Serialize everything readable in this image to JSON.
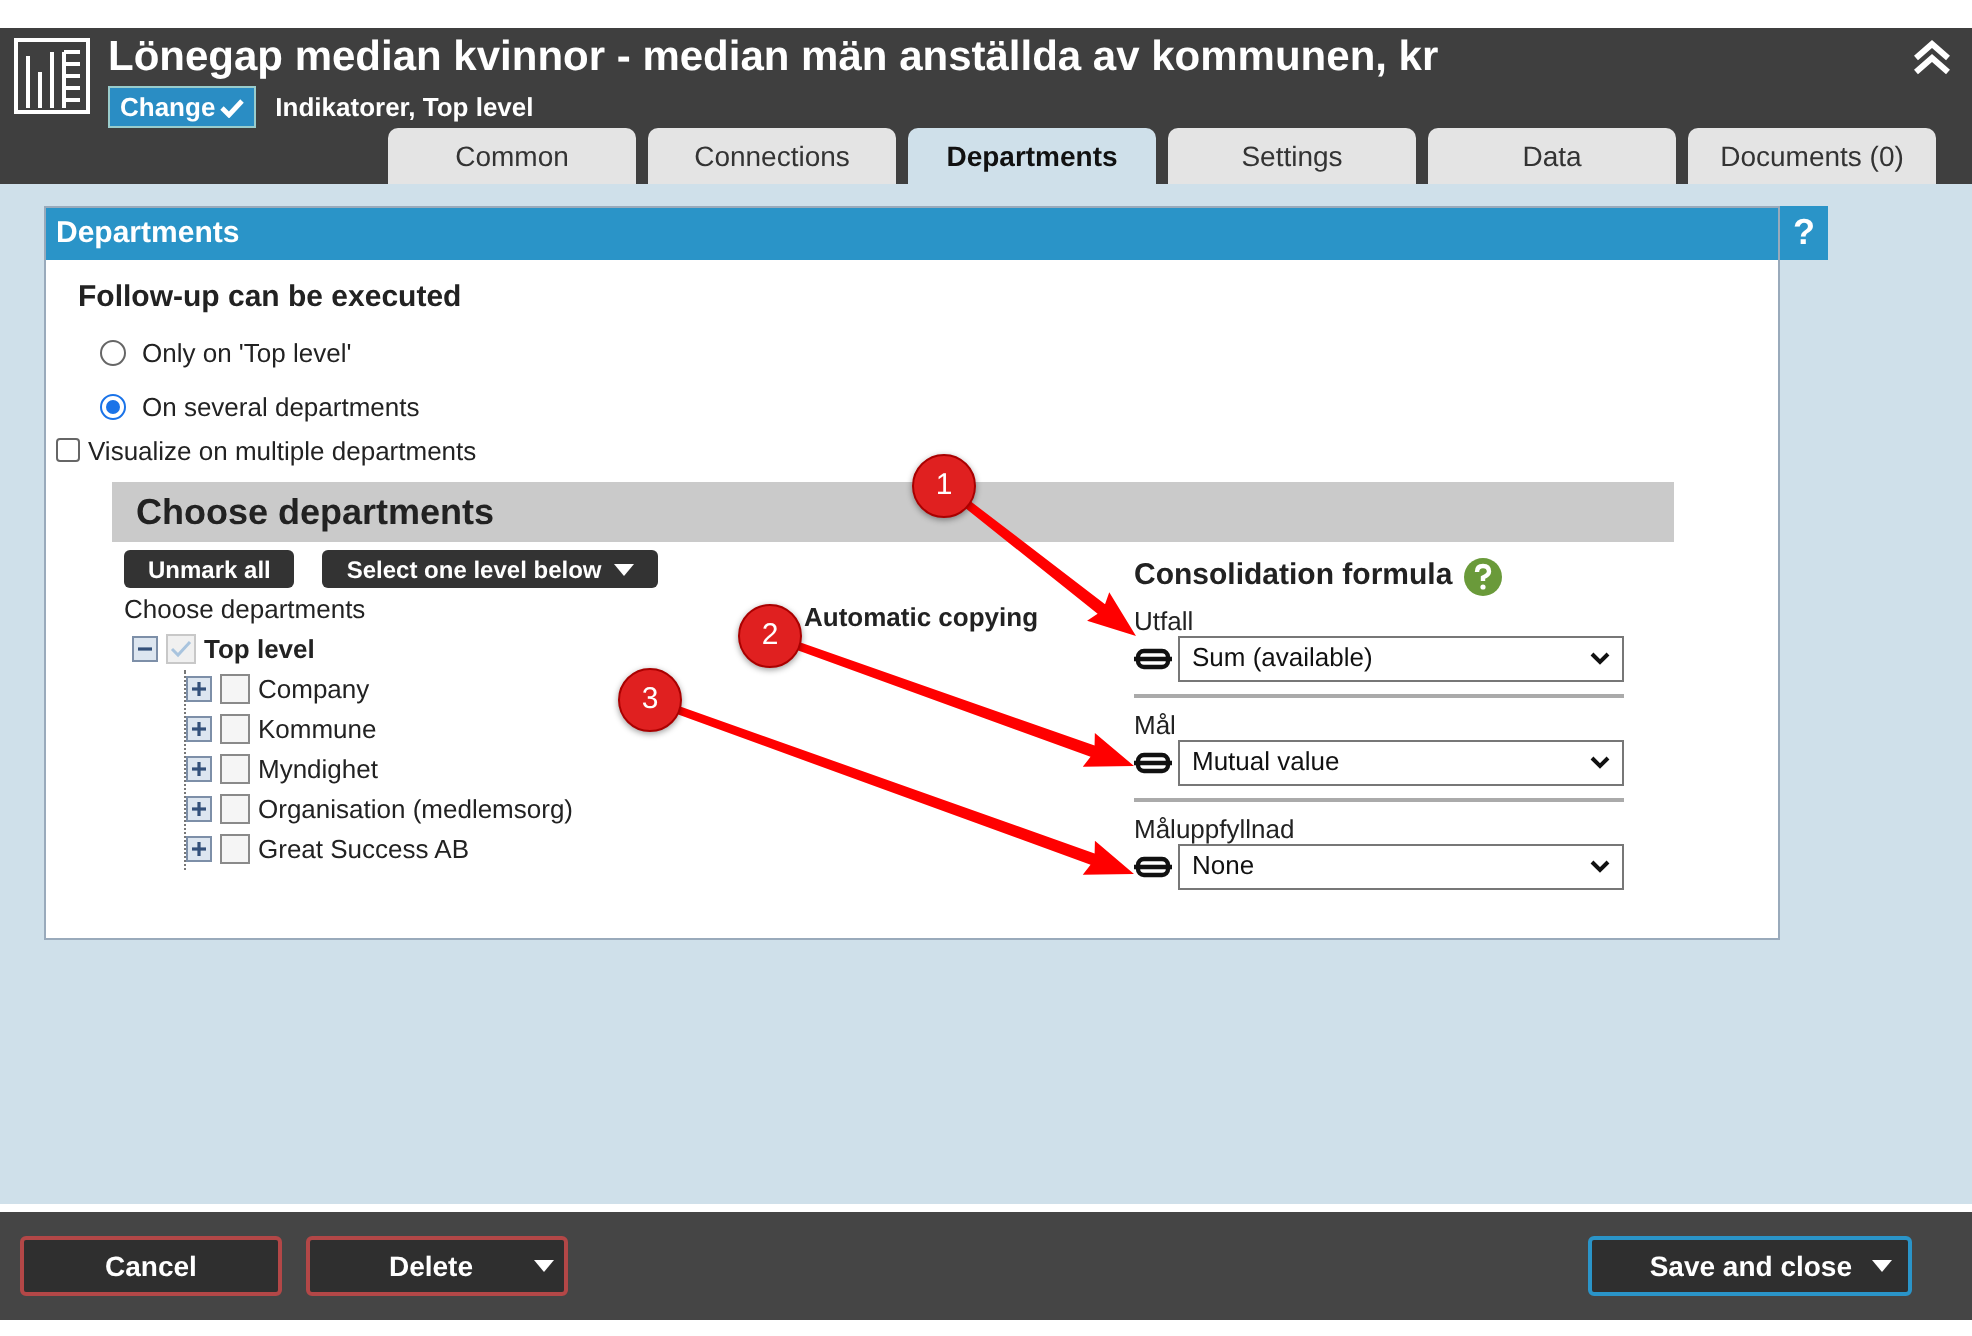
{
  "header": {
    "title": "Lönegap median kvinnor - median män anställda av kommunen, kr",
    "change_button": "Change",
    "subtitle": "Indikatorer, Top level"
  },
  "tabs": [
    {
      "label": "Common",
      "selected": false
    },
    {
      "label": "Connections",
      "selected": false
    },
    {
      "label": "Departments",
      "selected": true
    },
    {
      "label": "Settings",
      "selected": false
    },
    {
      "label": "Data",
      "selected": false
    },
    {
      "label": "Documents (0)",
      "selected": false
    }
  ],
  "panel": {
    "title": "Departments",
    "help": "?",
    "heading": "Follow-up can be executed",
    "radios": [
      {
        "label": "Only on 'Top level'",
        "selected": false
      },
      {
        "label": "On several departments",
        "selected": true
      }
    ],
    "visualize": {
      "label": "Visualize on multiple departments",
      "checked": false
    },
    "choose_title": "Choose departments",
    "unmark_button": "Unmark all",
    "level_button": "Select one level below",
    "tree_label": "Choose departments",
    "tree": [
      {
        "label": "Top level",
        "checked": true,
        "expanded": true,
        "children": [
          {
            "label": "Company",
            "checked": false,
            "expanded": false
          },
          {
            "label": "Kommune",
            "checked": false,
            "expanded": false
          },
          {
            "label": "Myndighet",
            "checked": false,
            "expanded": false
          },
          {
            "label": "Organisation (medlemsorg)",
            "checked": false,
            "expanded": false
          },
          {
            "label": "Great Success AB",
            "checked": false,
            "expanded": false
          }
        ]
      }
    ],
    "auto_copy": "Automatic copying",
    "consolidation_title": "Consolidation formula",
    "formulas": [
      {
        "label": "Utfall",
        "value": "Sum (available)"
      },
      {
        "label": "Mål",
        "value": "Mutual value"
      },
      {
        "label": "Måluppfyllnad",
        "value": "None"
      }
    ]
  },
  "annotations": [
    {
      "label": "1"
    },
    {
      "label": "2"
    },
    {
      "label": "3"
    }
  ],
  "footer": {
    "cancel": "Cancel",
    "delete": "Delete",
    "save": "Save and close"
  }
}
